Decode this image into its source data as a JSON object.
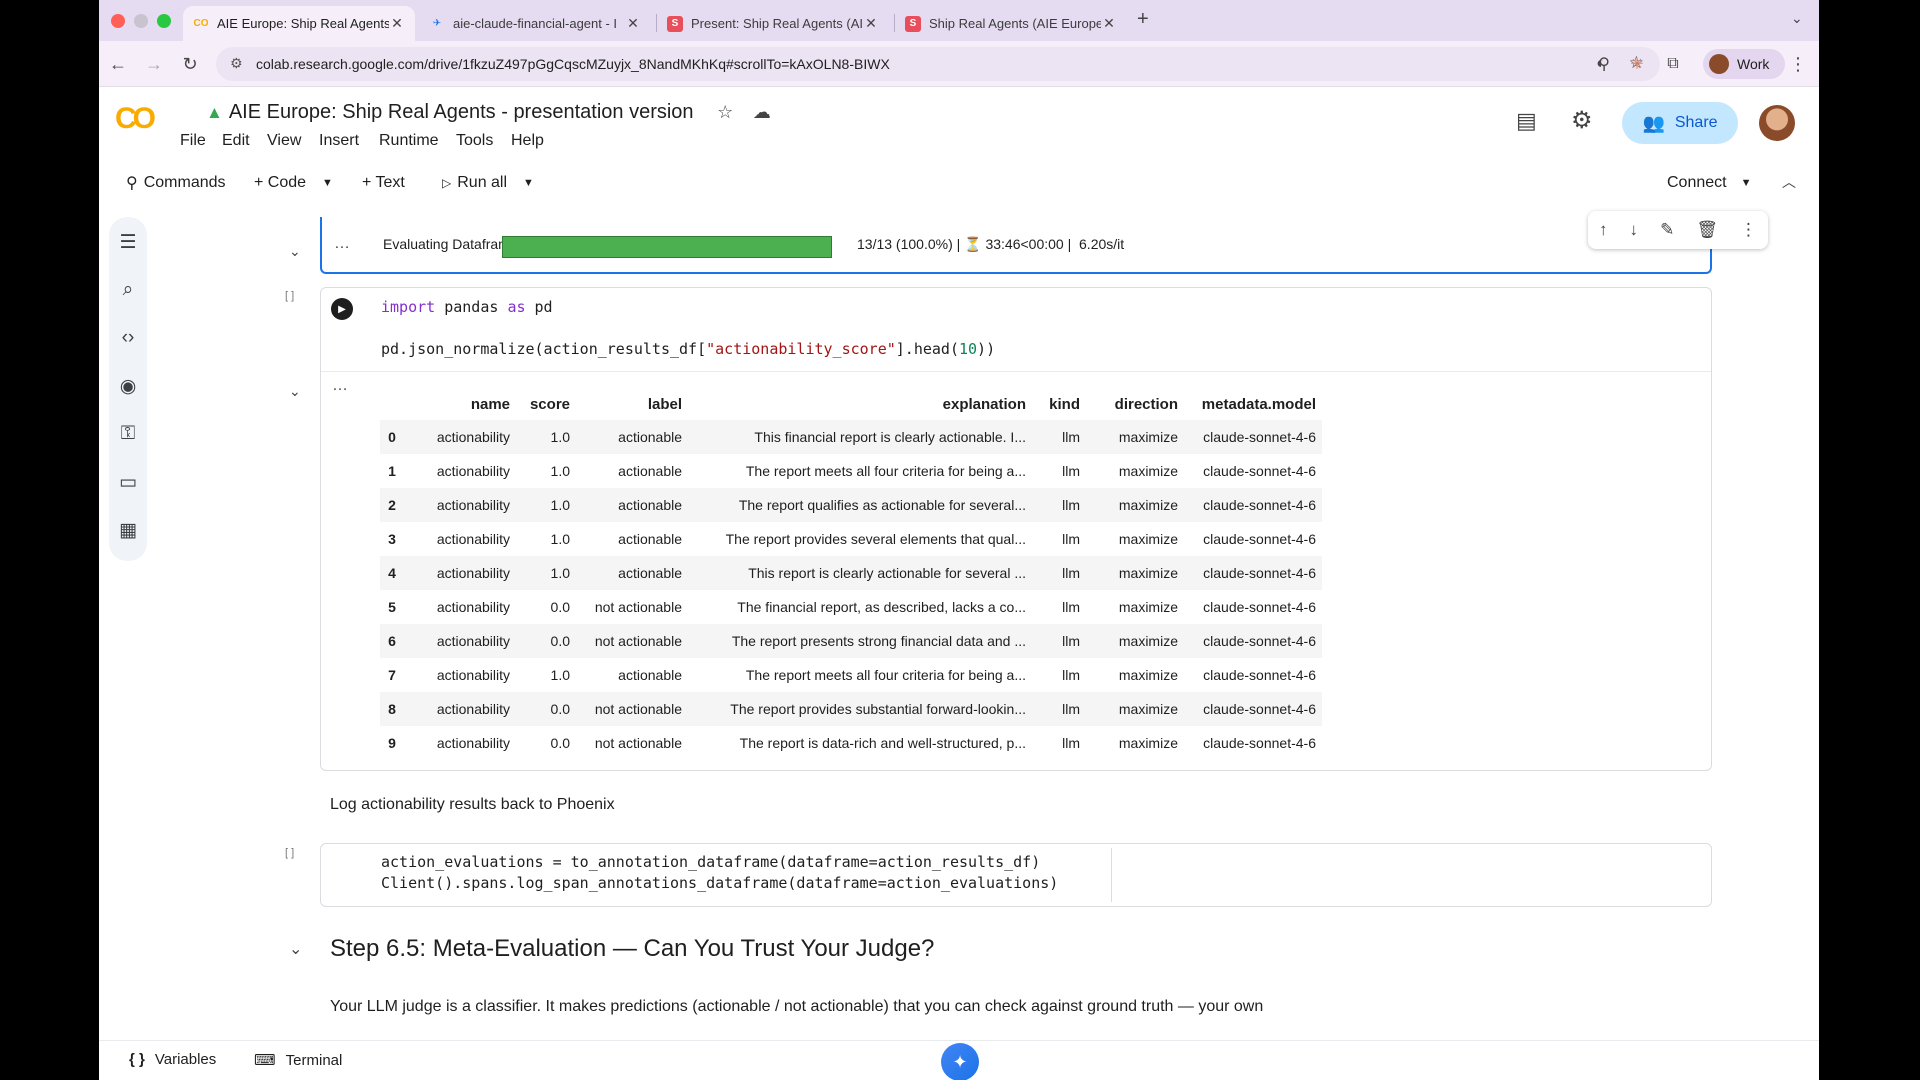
{
  "browser": {
    "tabs": [
      {
        "title": "AIE Europe: Ship Real Agents",
        "active": true,
        "favicon": "colab-icon"
      },
      {
        "title": "aie-claude-financial-agent - I",
        "active": false,
        "favicon": "phoenix-icon"
      },
      {
        "title": "Present: Ship Real Agents (AI",
        "active": false,
        "favicon": "slides-icon"
      },
      {
        "title": "Ship Real Agents (AIE Europe",
        "active": false,
        "favicon": "slides-icon"
      }
    ],
    "url": "colab.research.google.com/drive/1fkzuZ497pGgCqscMZuyjx_8NandMKhKq#scrollTo=kAxOLN8-BIWX",
    "profile_label": "Work"
  },
  "colab": {
    "doc_title": "AIE Europe: Ship Real Agents - presentation version",
    "menu": [
      "File",
      "Edit",
      "View",
      "Insert",
      "Runtime",
      "Tools",
      "Help"
    ],
    "share_label": "Share",
    "toolbar": {
      "commands": "Commands",
      "code": "+ Code",
      "text": "+ Text",
      "run_all": "Run all",
      "connect": "Connect"
    },
    "accent_color": "#1a73e8"
  },
  "progress_cell": {
    "label": "Evaluating Dataframe",
    "progress": 1.0,
    "stats": "13/13 (100.0%) | ⏳ 33:46<00:00 |  6.20s/it"
  },
  "code_cell_1": {
    "bracket": "[ ]",
    "line1_kw1": "import",
    "line1_mod": " pandas ",
    "line1_kw2": "as",
    "line1_alias": " pd",
    "line2_pre": "pd.json_normalize(action_results_df[",
    "line2_str": "\"actionability_score\"",
    "line2_mid": "].head(",
    "line2_num": "10",
    "line2_post": "))"
  },
  "dataframe": {
    "columns": [
      "",
      "name",
      "score",
      "label",
      "explanation",
      "kind",
      "direction",
      "metadata.model"
    ],
    "rows": [
      [
        "0",
        "actionability",
        "1.0",
        "actionable",
        "This financial report is clearly actionable. I...",
        "llm",
        "maximize",
        "claude-sonnet-4-6"
      ],
      [
        "1",
        "actionability",
        "1.0",
        "actionable",
        "The report meets all four criteria for being a...",
        "llm",
        "maximize",
        "claude-sonnet-4-6"
      ],
      [
        "2",
        "actionability",
        "1.0",
        "actionable",
        "The report qualifies as actionable for several...",
        "llm",
        "maximize",
        "claude-sonnet-4-6"
      ],
      [
        "3",
        "actionability",
        "1.0",
        "actionable",
        "The report provides several elements that qual...",
        "llm",
        "maximize",
        "claude-sonnet-4-6"
      ],
      [
        "4",
        "actionability",
        "1.0",
        "actionable",
        "This report is clearly actionable for several ...",
        "llm",
        "maximize",
        "claude-sonnet-4-6"
      ],
      [
        "5",
        "actionability",
        "0.0",
        "not actionable",
        "The financial report, as described, lacks a co...",
        "llm",
        "maximize",
        "claude-sonnet-4-6"
      ],
      [
        "6",
        "actionability",
        "0.0",
        "not actionable",
        "The report presents strong financial data and ...",
        "llm",
        "maximize",
        "claude-sonnet-4-6"
      ],
      [
        "7",
        "actionability",
        "1.0",
        "actionable",
        "The report meets all four criteria for being a...",
        "llm",
        "maximize",
        "claude-sonnet-4-6"
      ],
      [
        "8",
        "actionability",
        "0.0",
        "not actionable",
        "The report provides substantial forward-lookin...",
        "llm",
        "maximize",
        "claude-sonnet-4-6"
      ],
      [
        "9",
        "actionability",
        "0.0",
        "not actionable",
        "The report is data-rich and well-structured, p...",
        "llm",
        "maximize",
        "claude-sonnet-4-6"
      ]
    ]
  },
  "markdown_1": "Log actionability results back to Phoenix",
  "code_cell_2": {
    "bracket": "[ ]",
    "line1": "action_evaluations = to_annotation_dataframe(dataframe=action_results_df)",
    "line2": "Client().spans.log_span_annotations_dataframe(dataframe=action_evaluations)"
  },
  "section_heading": "Step 6.5: Meta-Evaluation — Can You Trust Your Judge?",
  "markdown_2": "Your LLM judge is a classifier. It makes predictions (actionable / not actionable) that you can check against ground truth — your own",
  "bottom_bar": {
    "variables": "Variables",
    "terminal": "Terminal"
  }
}
